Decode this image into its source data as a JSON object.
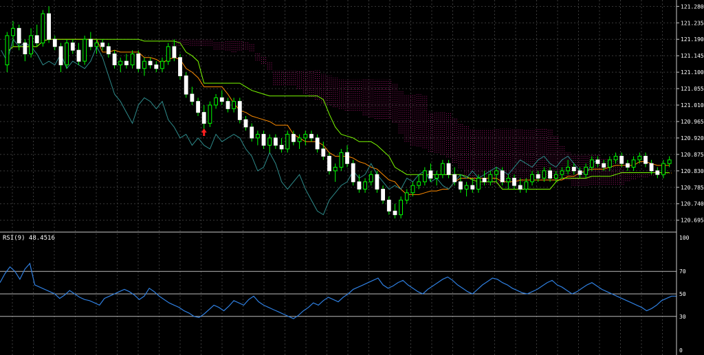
{
  "chart_data": [
    {
      "type": "candlestick",
      "title": "",
      "y_ticks": [
        "121.280",
        "121.235",
        "121.190",
        "121.145",
        "121.100",
        "121.055",
        "121.010",
        "120.965",
        "120.920",
        "120.875",
        "120.830",
        "120.785",
        "120.740",
        "120.695"
      ],
      "ylim": [
        120.67,
        121.29
      ],
      "grid": true,
      "colors": {
        "up_body": "#000000",
        "up_wick": "#00ff00",
        "down_body": "#ffffff",
        "tenkan": "#ff8c00",
        "kijun": "#7cfc00",
        "chikou": "#2e8b8b",
        "kumo_up": "#ffa500",
        "kumo_down": "#c71585",
        "arrow": "#ff2020"
      },
      "candles": [
        [
          121.12,
          121.21,
          121.1,
          121.2
        ],
        [
          121.2,
          121.24,
          121.17,
          121.22
        ],
        [
          121.22,
          121.23,
          121.16,
          121.18
        ],
        [
          121.18,
          121.19,
          121.13,
          121.15
        ],
        [
          121.15,
          121.22,
          121.14,
          121.2
        ],
        [
          121.2,
          121.23,
          121.17,
          121.18
        ],
        [
          121.18,
          121.27,
          121.17,
          121.26
        ],
        [
          121.26,
          121.28,
          121.18,
          121.19
        ],
        [
          121.19,
          121.2,
          121.16,
          121.17
        ],
        [
          121.17,
          121.18,
          121.1,
          121.12
        ],
        [
          121.12,
          121.19,
          121.11,
          121.18
        ],
        [
          121.18,
          121.19,
          121.15,
          121.16
        ],
        [
          121.16,
          121.18,
          121.12,
          121.13
        ],
        [
          121.13,
          121.2,
          121.12,
          121.19
        ],
        [
          121.19,
          121.21,
          121.16,
          121.17
        ],
        [
          121.17,
          121.19,
          121.15,
          121.18
        ],
        [
          121.18,
          121.19,
          121.16,
          121.17
        ],
        [
          121.17,
          121.18,
          121.14,
          121.15
        ],
        [
          121.15,
          121.16,
          121.11,
          121.12
        ],
        [
          121.12,
          121.14,
          121.1,
          121.13
        ],
        [
          121.13,
          121.15,
          121.11,
          121.12
        ],
        [
          121.12,
          121.16,
          121.11,
          121.15
        ],
        [
          121.15,
          121.16,
          121.1,
          121.11
        ],
        [
          121.11,
          121.14,
          121.09,
          121.13
        ],
        [
          121.13,
          121.14,
          121.11,
          121.12
        ],
        [
          121.12,
          121.13,
          121.1,
          121.11
        ],
        [
          121.11,
          121.14,
          121.1,
          121.13
        ],
        [
          121.13,
          121.18,
          121.12,
          121.17
        ],
        [
          121.17,
          121.19,
          121.13,
          121.14
        ],
        [
          121.14,
          121.15,
          121.08,
          121.09
        ],
        [
          121.09,
          121.1,
          121.03,
          121.04
        ],
        [
          121.04,
          121.06,
          121.01,
          121.02
        ],
        [
          121.02,
          121.03,
          120.98,
          120.99
        ],
        [
          120.99,
          121.01,
          120.93,
          120.96
        ],
        [
          120.96,
          121.02,
          120.95,
          121.01
        ],
        [
          121.01,
          121.04,
          121.0,
          121.03
        ],
        [
          121.03,
          121.05,
          121.01,
          121.02
        ],
        [
          121.02,
          121.03,
          120.99,
          121.0
        ],
        [
          121.0,
          121.03,
          120.99,
          121.02
        ],
        [
          121.02,
          121.03,
          120.96,
          120.97
        ],
        [
          120.97,
          120.98,
          120.94,
          120.95
        ],
        [
          120.95,
          120.96,
          120.91,
          120.92
        ],
        [
          120.92,
          120.94,
          120.9,
          120.93
        ],
        [
          120.93,
          120.94,
          120.89,
          120.9
        ],
        [
          120.9,
          120.93,
          120.88,
          120.92
        ],
        [
          120.92,
          120.93,
          120.89,
          120.9
        ],
        [
          120.9,
          120.92,
          120.88,
          120.89
        ],
        [
          120.89,
          120.94,
          120.88,
          120.93
        ],
        [
          120.93,
          120.94,
          120.9,
          120.91
        ],
        [
          120.91,
          120.93,
          120.89,
          120.92
        ],
        [
          120.92,
          120.94,
          120.9,
          120.93
        ],
        [
          120.93,
          120.94,
          120.91,
          120.92
        ],
        [
          120.92,
          120.93,
          120.88,
          120.89
        ],
        [
          120.89,
          120.91,
          120.86,
          120.87
        ],
        [
          120.87,
          120.88,
          120.82,
          120.83
        ],
        [
          120.83,
          120.85,
          120.8,
          120.84
        ],
        [
          120.84,
          120.89,
          120.83,
          120.88
        ],
        [
          120.88,
          120.9,
          120.84,
          120.85
        ],
        [
          120.85,
          120.86,
          120.79,
          120.8
        ],
        [
          120.8,
          120.82,
          120.77,
          120.78
        ],
        [
          120.78,
          120.81,
          120.77,
          120.8
        ],
        [
          120.8,
          120.83,
          120.79,
          120.82
        ],
        [
          120.82,
          120.83,
          120.77,
          120.78
        ],
        [
          120.78,
          120.79,
          120.74,
          120.75
        ],
        [
          120.75,
          120.76,
          120.71,
          120.72
        ],
        [
          120.72,
          120.74,
          120.7,
          120.71
        ],
        [
          120.71,
          120.76,
          120.7,
          120.75
        ],
        [
          120.75,
          120.78,
          120.74,
          120.77
        ],
        [
          120.77,
          120.8,
          120.76,
          120.79
        ],
        [
          120.79,
          120.82,
          120.78,
          120.8
        ],
        [
          120.8,
          120.84,
          120.79,
          120.83
        ],
        [
          120.83,
          120.85,
          120.8,
          120.81
        ],
        [
          120.81,
          120.83,
          120.79,
          120.82
        ],
        [
          120.82,
          120.86,
          120.81,
          120.85
        ],
        [
          120.85,
          120.86,
          120.81,
          120.82
        ],
        [
          120.82,
          120.84,
          120.79,
          120.8
        ],
        [
          120.8,
          120.82,
          120.77,
          120.78
        ],
        [
          120.78,
          120.8,
          120.76,
          120.79
        ],
        [
          120.79,
          120.81,
          120.77,
          120.78
        ],
        [
          120.78,
          120.82,
          120.77,
          120.81
        ],
        [
          120.81,
          120.83,
          120.79,
          120.8
        ],
        [
          120.8,
          120.83,
          120.79,
          120.82
        ],
        [
          120.82,
          120.84,
          120.8,
          120.83
        ],
        [
          120.83,
          120.84,
          120.79,
          120.8
        ],
        [
          120.8,
          120.82,
          120.78,
          120.81
        ],
        [
          120.81,
          120.82,
          120.78,
          120.79
        ],
        [
          120.79,
          120.81,
          120.77,
          120.78
        ],
        [
          120.78,
          120.81,
          120.77,
          120.8
        ],
        [
          120.8,
          120.83,
          120.79,
          120.82
        ],
        [
          120.82,
          120.83,
          120.8,
          120.81
        ],
        [
          120.81,
          120.84,
          120.8,
          120.83
        ],
        [
          120.83,
          120.84,
          120.8,
          120.81
        ],
        [
          120.81,
          120.83,
          120.8,
          120.82
        ],
        [
          120.82,
          120.84,
          120.81,
          120.83
        ],
        [
          120.83,
          120.86,
          120.82,
          120.84
        ],
        [
          120.84,
          120.85,
          120.82,
          120.83
        ],
        [
          120.83,
          120.84,
          120.81,
          120.82
        ],
        [
          120.82,
          120.85,
          120.81,
          120.84
        ],
        [
          120.84,
          120.87,
          120.83,
          120.86
        ],
        [
          120.86,
          120.87,
          120.84,
          120.85
        ],
        [
          120.85,
          120.86,
          120.83,
          120.84
        ],
        [
          120.84,
          120.87,
          120.83,
          120.86
        ],
        [
          120.86,
          120.88,
          120.85,
          120.87
        ],
        [
          120.87,
          120.88,
          120.84,
          120.85
        ],
        [
          120.85,
          120.86,
          120.83,
          120.84
        ],
        [
          120.84,
          120.87,
          120.83,
          120.86
        ],
        [
          120.86,
          120.88,
          120.85,
          120.87
        ],
        [
          120.87,
          120.88,
          120.84,
          120.85
        ],
        [
          120.85,
          120.86,
          120.82,
          120.83
        ],
        [
          120.83,
          120.84,
          120.81,
          120.82
        ],
        [
          120.82,
          120.86,
          120.81,
          120.85
        ],
        [
          120.85,
          120.87,
          120.84,
          120.86
        ]
      ]
    },
    {
      "type": "line",
      "title": "",
      "label": "RSI(9) 48.4516",
      "y_ticks": [
        "100",
        "70",
        "50",
        "30",
        "0"
      ],
      "ylim": [
        0,
        100
      ],
      "levels": [
        70,
        50,
        30
      ],
      "series": [
        {
          "values": [
            60,
            68,
            74,
            70,
            63,
            72,
            77,
            58,
            56,
            54,
            52,
            50,
            46,
            49,
            53,
            50,
            47,
            45,
            44,
            42,
            40,
            46,
            48,
            50,
            52,
            54,
            52,
            49,
            45,
            48,
            55,
            52,
            48,
            45,
            42,
            40,
            38,
            35,
            33,
            30,
            29,
            32,
            36,
            40,
            38,
            35,
            39,
            44,
            42,
            40,
            45,
            48,
            43,
            40,
            38,
            36,
            34,
            32,
            30,
            28,
            31,
            35,
            38,
            42,
            40,
            44,
            47,
            45,
            43,
            47,
            50,
            54,
            56,
            58,
            60,
            62,
            64,
            58,
            55,
            57,
            60,
            62,
            58,
            55,
            52,
            50,
            54,
            57,
            60,
            63,
            65,
            62,
            58,
            55,
            52,
            50,
            54,
            58,
            61,
            64,
            63,
            60,
            58,
            55,
            53,
            51,
            50,
            52,
            54,
            57,
            60,
            62,
            58,
            56,
            53,
            50,
            52,
            55,
            58,
            60,
            57,
            54,
            52,
            50,
            48,
            46,
            44,
            42,
            40,
            38,
            35,
            37,
            40,
            44,
            46,
            48,
            48
          ]
        }
      ]
    }
  ]
}
